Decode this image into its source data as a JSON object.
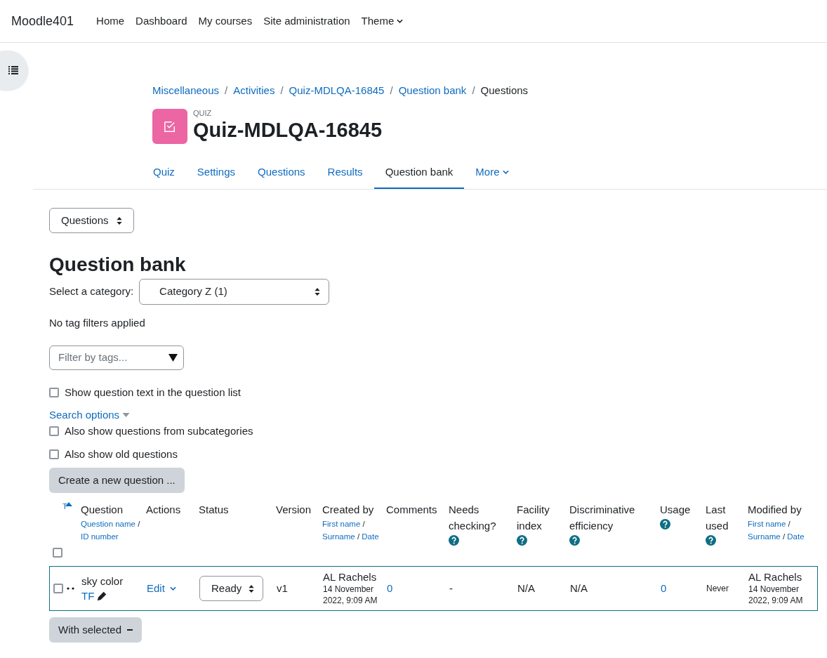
{
  "navbar": {
    "brand": "Moodle401",
    "links": [
      {
        "label": "Home"
      },
      {
        "label": "Dashboard"
      },
      {
        "label": "My courses"
      },
      {
        "label": "Site administration"
      },
      {
        "label": "Theme",
        "dropdown": true
      }
    ]
  },
  "breadcrumb": [
    {
      "label": "Miscellaneous",
      "link": true
    },
    {
      "separator": "/",
      "label": "Activities",
      "link": true
    },
    {
      "separator": "/",
      "label": "Quiz-MDLQA-16845",
      "link": true
    },
    {
      "separator": "/",
      "label": "Question bank",
      "link": true
    },
    {
      "separator": "/",
      "label": "Questions",
      "link": false
    }
  ],
  "header": {
    "kind_label": "QUIZ",
    "title": "Quiz-MDLQA-16845"
  },
  "tabs": [
    {
      "label": "Quiz",
      "selected": false
    },
    {
      "label": "Settings",
      "selected": false
    },
    {
      "label": "Questions",
      "selected": false
    },
    {
      "label": "Results",
      "selected": false
    },
    {
      "label": "Question bank",
      "selected": true
    },
    {
      "label": "More",
      "selected": false,
      "dropdown": true
    }
  ],
  "page_select": {
    "value": "Questions"
  },
  "heading": "Question bank",
  "category": {
    "label": "Select a category:",
    "value": "Category Z (1)"
  },
  "tag_status": "No tag filters applied",
  "tag_filter": {
    "placeholder": "Filter by tags..."
  },
  "show_text_option": {
    "label": "Show question text in the question list",
    "checked": false
  },
  "search_options": {
    "label": "Search options",
    "options": [
      {
        "label": "Also show questions from subcategories",
        "checked": false
      },
      {
        "label": "Also show old questions",
        "checked": false
      }
    ]
  },
  "create_button": "Create a new question ...",
  "table": {
    "select_all_checked": false,
    "columns": [
      {
        "title": "T",
        "sorted_asc": true
      },
      {
        "title": "Question",
        "sort": [
          {
            "kind": "link",
            "text": "Question name"
          },
          {
            "kind": "sep",
            "text": "/"
          },
          {
            "kind": "link",
            "text": "ID number"
          }
        ]
      },
      {
        "title": "Actions"
      },
      {
        "title": "Status"
      },
      {
        "title": "Version"
      },
      {
        "title": "Created by",
        "sort": [
          {
            "kind": "link",
            "text": "First name"
          },
          {
            "kind": "sep",
            "text": "/"
          },
          {
            "kind": "link",
            "text": "Surname"
          },
          {
            "kind": "sep",
            "text": "/"
          },
          {
            "kind": "link",
            "text": "Date"
          }
        ]
      },
      {
        "title": "Comments"
      },
      {
        "title": "Needs checking?",
        "help": true
      },
      {
        "title": "Facility index",
        "help": true
      },
      {
        "title": "Discriminative efficiency",
        "help": true
      },
      {
        "title": "Usage",
        "help": true
      },
      {
        "title": "Last used",
        "help": true
      },
      {
        "title": "Modified by",
        "sort": [
          {
            "kind": "link",
            "text": "First name"
          },
          {
            "kind": "sep",
            "text": "/"
          },
          {
            "kind": "link",
            "text": "Surname"
          },
          {
            "kind": "sep",
            "text": "/"
          },
          {
            "kind": "link",
            "text": "Date"
          }
        ]
      }
    ],
    "rows": [
      {
        "checked": false,
        "name": "sky color",
        "type": "TF",
        "action": "Edit",
        "status": "Ready",
        "version": "v1",
        "created_by": "AL Rachels",
        "created_date": "14 November 2022, 9:09 AM",
        "comments": "0",
        "needs_checking": "-",
        "facility_index": "N/A",
        "discriminative_efficiency": "N/A",
        "usage": "0",
        "last_used": "Never",
        "modified_by": "AL Rachels",
        "modified_date": "14 November 2022, 9:09 AM"
      }
    ]
  },
  "bulk_button": "With selected"
}
